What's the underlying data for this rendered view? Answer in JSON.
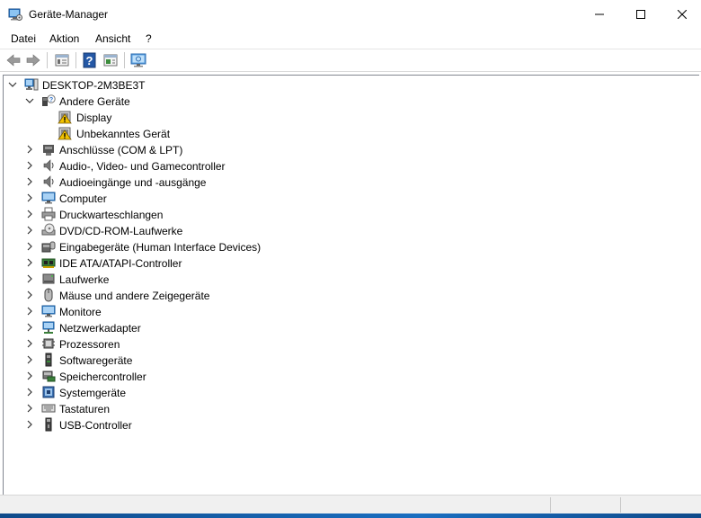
{
  "window": {
    "title": "Geräte-Manager",
    "icon": "device-manager-icon"
  },
  "menu": {
    "items": [
      "Datei",
      "Aktion",
      "Ansicht",
      "?"
    ]
  },
  "toolbar": {
    "buttons": [
      "back-arrow-icon",
      "forward-arrow-icon",
      "properties-icon",
      "help-icon",
      "view-icon",
      "monitor-scan-icon"
    ]
  },
  "tree": {
    "root": {
      "label": "DESKTOP-2M3BE3T",
      "icon": "computer-icon",
      "expanded": true
    },
    "nodes": [
      {
        "label": "Andere Geräte",
        "icon": "unknown-device-icon",
        "expanded": true,
        "children": [
          {
            "label": "Display",
            "icon": "warning-device-icon",
            "highlighted": true
          },
          {
            "label": "Unbekanntes Gerät",
            "icon": "warning-device-icon"
          }
        ]
      },
      {
        "label": "Anschlüsse (COM & LPT)",
        "icon": "port-icon"
      },
      {
        "label": "Audio-, Video- und Gamecontroller",
        "icon": "speaker-icon"
      },
      {
        "label": "Audioeingänge und -ausgänge",
        "icon": "speaker-icon"
      },
      {
        "label": "Computer",
        "icon": "computer-icon"
      },
      {
        "label": "Druckwarteschlangen",
        "icon": "printer-icon"
      },
      {
        "label": "DVD/CD-ROM-Laufwerke",
        "icon": "disc-drive-icon"
      },
      {
        "label": "Eingabegeräte (Human Interface Devices)",
        "icon": "hid-icon"
      },
      {
        "label": "IDE ATA/ATAPI-Controller",
        "icon": "ide-controller-icon"
      },
      {
        "label": "Laufwerke",
        "icon": "disk-drive-icon"
      },
      {
        "label": "Mäuse und andere Zeigegeräte",
        "icon": "mouse-icon"
      },
      {
        "label": "Monitore",
        "icon": "monitor-icon"
      },
      {
        "label": "Netzwerkadapter",
        "icon": "network-adapter-icon"
      },
      {
        "label": "Prozessoren",
        "icon": "processor-icon"
      },
      {
        "label": "Softwaregeräte",
        "icon": "software-device-icon"
      },
      {
        "label": "Speichercontroller",
        "icon": "storage-controller-icon"
      },
      {
        "label": "Systemgeräte",
        "icon": "system-device-icon"
      },
      {
        "label": "Tastaturen",
        "icon": "keyboard-icon"
      },
      {
        "label": "USB-Controller",
        "icon": "usb-icon"
      }
    ]
  },
  "colors": {
    "highlight": "#ffff00",
    "selection_accent": "#0078d7",
    "warning": "#f2c200"
  }
}
